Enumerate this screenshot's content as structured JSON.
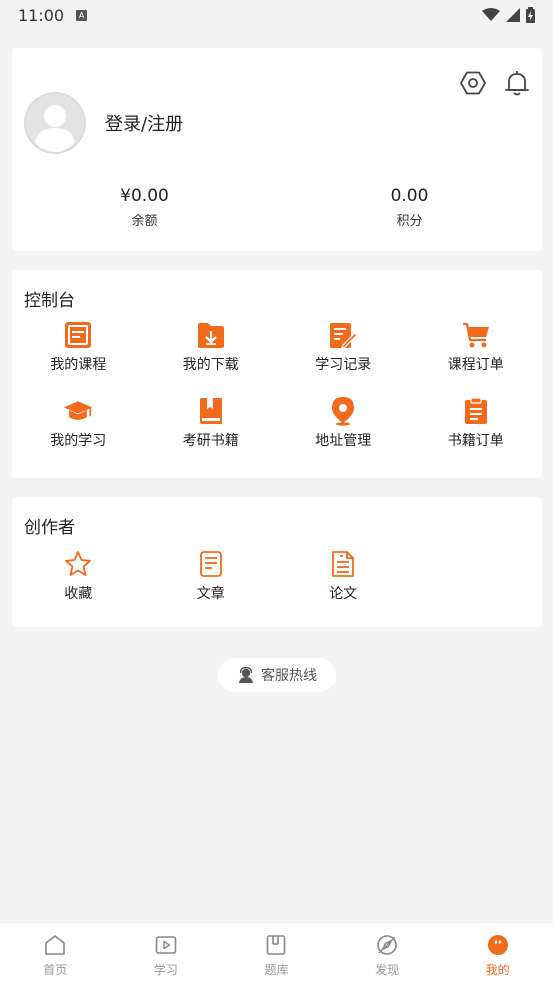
{
  "colors": {
    "accent": "#f26a1b",
    "background": "#f4f4f4",
    "inactive": "#999999"
  },
  "status_bar": {
    "time": "11:00",
    "icons": [
      "a-icon",
      "wifi-icon",
      "signal-icon",
      "battery-icon"
    ]
  },
  "profile": {
    "login_label": "登录/注册",
    "balance": {
      "value": "¥0.00",
      "label": "余额"
    },
    "points": {
      "value": "0.00",
      "label": "积分"
    },
    "icons": [
      "settings-icon",
      "bell-icon"
    ]
  },
  "console": {
    "title": "控制台",
    "items": [
      {
        "label": "我的课程",
        "icon": "course-icon"
      },
      {
        "label": "我的下载",
        "icon": "download-icon"
      },
      {
        "label": "学习记录",
        "icon": "study-record-icon"
      },
      {
        "label": "课程订单",
        "icon": "cart-icon"
      },
      {
        "label": "我的学习",
        "icon": "graduation-cap-icon"
      },
      {
        "label": "考研书籍",
        "icon": "book-icon"
      },
      {
        "label": "地址管理",
        "icon": "location-pin-icon"
      },
      {
        "label": "书籍订单",
        "icon": "clipboard-icon"
      }
    ]
  },
  "creator": {
    "title": "创作者",
    "items": [
      {
        "label": "收藏",
        "icon": "star-icon"
      },
      {
        "label": "文章",
        "icon": "article-icon"
      },
      {
        "label": "论文",
        "icon": "paper-icon"
      }
    ]
  },
  "hotline": {
    "label": "客服热线",
    "icon": "headset-user-icon"
  },
  "bottom_nav": {
    "items": [
      {
        "label": "首页",
        "icon": "home-icon",
        "active": false
      },
      {
        "label": "学习",
        "icon": "play-icon",
        "active": false
      },
      {
        "label": "题库",
        "icon": "question-bank-icon",
        "active": false
      },
      {
        "label": "发现",
        "icon": "compass-icon",
        "active": false
      },
      {
        "label": "我的",
        "icon": "profile-face-icon",
        "active": true
      }
    ]
  }
}
